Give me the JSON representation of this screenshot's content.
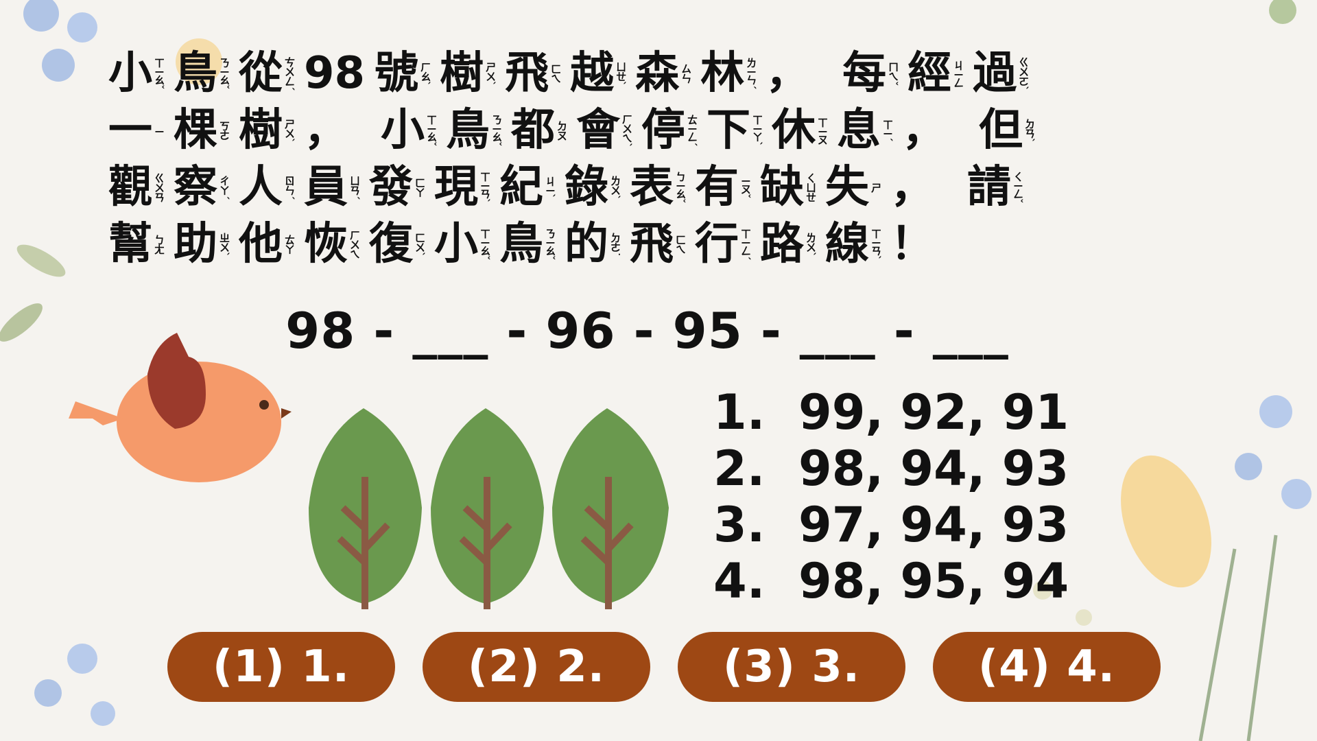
{
  "question": {
    "lines": [
      [
        [
          "小",
          "ㄒㄧㄠˇ"
        ],
        [
          "鳥",
          "ㄋㄧㄠˇ"
        ],
        [
          "從",
          "ㄘㄨㄥˊ"
        ],
        [
          "98",
          ""
        ],
        [
          "號",
          "ㄏㄠˋ"
        ],
        [
          "樹",
          "ㄕㄨˋ"
        ],
        [
          "飛",
          "ㄈㄟ"
        ],
        [
          "越",
          "ㄩㄝˋ"
        ],
        [
          "森",
          "ㄙㄣ"
        ],
        [
          "林",
          "ㄌㄧㄣˊ"
        ],
        [
          "，",
          ""
        ],
        [
          "每",
          "ㄇㄟˇ"
        ],
        [
          "經",
          "ㄐㄧㄥ"
        ],
        [
          "過",
          "ㄍㄨㄛˋ"
        ]
      ],
      [
        [
          "一",
          "ㄧ"
        ],
        [
          "棵",
          "ㄎㄜ"
        ],
        [
          "樹",
          "ㄕㄨˋ"
        ],
        [
          "，",
          ""
        ],
        [
          "小",
          "ㄒㄧㄠˇ"
        ],
        [
          "鳥",
          "ㄋㄧㄠˇ"
        ],
        [
          "都",
          "ㄉㄡ"
        ],
        [
          "會",
          "ㄏㄨㄟˋ"
        ],
        [
          "停",
          "ㄊㄧㄥˊ"
        ],
        [
          "下",
          "ㄒㄧㄚˋ"
        ],
        [
          "休",
          "ㄒㄧㄡ"
        ],
        [
          "息",
          "ㄒㄧˊ"
        ],
        [
          "，",
          ""
        ],
        [
          "但",
          "ㄉㄢˋ"
        ]
      ],
      [
        [
          "觀",
          "ㄍㄨㄢ"
        ],
        [
          "察",
          "ㄔㄚˊ"
        ],
        [
          "人",
          "ㄖㄣˊ"
        ],
        [
          "員",
          "ㄩㄢˊ"
        ],
        [
          "發",
          "ㄈㄚ"
        ],
        [
          "現",
          "ㄒㄧㄢˋ"
        ],
        [
          "紀",
          "ㄐㄧˋ"
        ],
        [
          "錄",
          "ㄌㄨˋ"
        ],
        [
          "表",
          "ㄅㄧㄠˇ"
        ],
        [
          "有",
          "ㄧㄡˇ"
        ],
        [
          "缺",
          "ㄑㄩㄝ"
        ],
        [
          "失",
          "ㄕ"
        ],
        [
          "，",
          ""
        ],
        [
          "請",
          "ㄑㄧㄥˇ"
        ]
      ],
      [
        [
          "幫",
          "ㄅㄤ"
        ],
        [
          "助",
          "ㄓㄨˋ"
        ],
        [
          "他",
          "ㄊㄚ"
        ],
        [
          "恢",
          "ㄏㄨㄟ"
        ],
        [
          "復",
          "ㄈㄨˋ"
        ],
        [
          "小",
          "ㄒㄧㄠˇ"
        ],
        [
          "鳥",
          "ㄋㄧㄠˇ"
        ],
        [
          "的",
          "ㄉㄜ˙"
        ],
        [
          "飛",
          "ㄈㄟ"
        ],
        [
          "行",
          "ㄒㄧㄥˊ"
        ],
        [
          "路",
          "ㄌㄨˋ"
        ],
        [
          "線",
          "ㄒㄧㄢˋ"
        ],
        [
          "！",
          ""
        ]
      ]
    ]
  },
  "sequence": "98 - ___ - 96 - 95 - ___ - ___",
  "options": [
    "1.  99, 92, 91",
    "2.  98, 94, 93",
    "3.  97, 94, 93",
    "4.  98, 95, 94"
  ],
  "answers": [
    "(1) 1.",
    "(2) 2.",
    "(3) 3.",
    "(4) 4."
  ],
  "colors": {
    "button": "#9e4814",
    "tree": "#6a994e",
    "trunk": "#8a5a44",
    "bird": "#f59a6a",
    "wing": "#9b3a2c"
  }
}
